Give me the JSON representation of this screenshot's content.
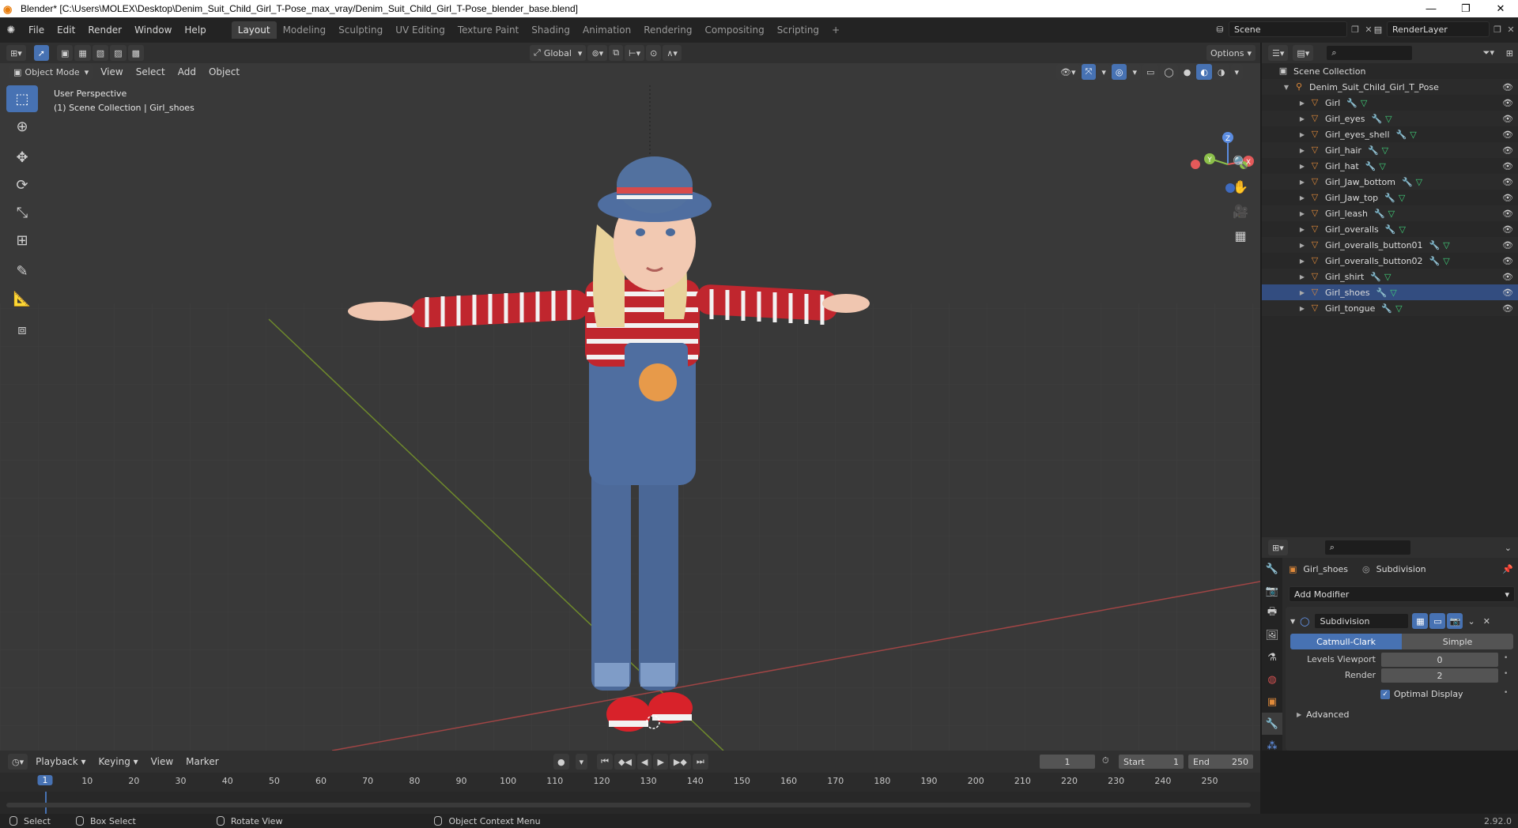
{
  "window": {
    "title": "Blender* [C:\\Users\\MOLEX\\Desktop\\Denim_Suit_Child_Girl_T-Pose_max_vray/Denim_Suit_Child_Girl_T-Pose_blender_base.blend]",
    "controls": [
      "—",
      "❐",
      "✕"
    ]
  },
  "menubar": {
    "items": [
      "File",
      "Edit",
      "Render",
      "Window",
      "Help"
    ],
    "workspaces": [
      "Layout",
      "Modeling",
      "Sculpting",
      "UV Editing",
      "Texture Paint",
      "Shading",
      "Animation",
      "Rendering",
      "Compositing",
      "Scripting"
    ],
    "active_workspace": "Layout",
    "add_tab": "+",
    "scene": "Scene",
    "view_layer": "RenderLayer"
  },
  "viewport": {
    "orientation": "Global",
    "options_label": "Options",
    "mode": "Object Mode",
    "menus": [
      "View",
      "Select",
      "Add",
      "Object"
    ],
    "info_line1": "User Perspective",
    "info_line2": "(1) Scene Collection | Girl_shoes",
    "gizmo": {
      "z": "Z",
      "y": "Y",
      "x": "X"
    }
  },
  "outliner": {
    "root": "Scene Collection",
    "collection": "Denim_Suit_Child_Girl_T_Pose",
    "objects": [
      "Girl",
      "Girl_eyes",
      "Girl_eyes_shell",
      "Girl_hair",
      "Girl_hat",
      "Girl_Jaw_bottom",
      "Girl_Jaw_top",
      "Girl_leash",
      "Girl_overalls",
      "Girl_overalls_button01",
      "Girl_overalls_button02",
      "Girl_shirt",
      "Girl_shoes",
      "Girl_tongue"
    ],
    "selected": "Girl_shoes"
  },
  "properties": {
    "object_name": "Girl_shoes",
    "modifier_context": "Subdivision",
    "add_modifier": "Add Modifier",
    "modifier": {
      "name": "Subdivision",
      "algo_catmull": "Catmull-Clark",
      "algo_simple": "Simple",
      "levels_viewport_label": "Levels Viewport",
      "levels_viewport_value": "0",
      "render_label": "Render",
      "render_value": "2",
      "optimal_display": "Optimal Display",
      "advanced": "Advanced"
    }
  },
  "timeline": {
    "menus": [
      "Playback",
      "Keying",
      "View",
      "Marker"
    ],
    "current_frame": "1",
    "start_label": "Start",
    "start_value": "1",
    "end_label": "End",
    "end_value": "250",
    "ruler_ticks": [
      "1",
      "10",
      "20",
      "30",
      "40",
      "50",
      "60",
      "70",
      "80",
      "90",
      "100",
      "110",
      "120",
      "130",
      "140",
      "150",
      "160",
      "170",
      "180",
      "190",
      "200",
      "210",
      "220",
      "230",
      "240",
      "250"
    ]
  },
  "statusbar": {
    "select": "Select",
    "box_select": "Box Select",
    "rotate_view": "Rotate View",
    "context_menu": "Object Context Menu",
    "version": "2.92.0"
  },
  "colors": {
    "accent": "#4772b3",
    "object_icon": "#e08a3a",
    "mesh_icon": "#40d07a",
    "modifier_icon": "#6aa0ff"
  }
}
